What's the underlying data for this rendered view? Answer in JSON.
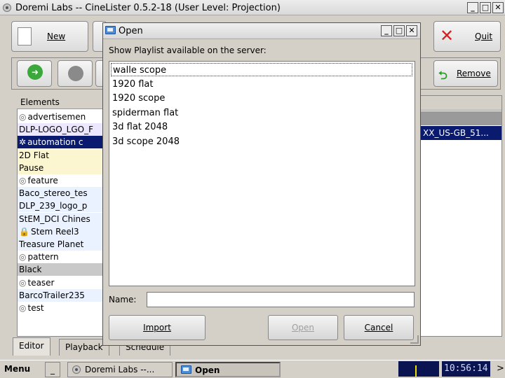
{
  "main_window": {
    "title": "Doremi Labs -- CineLister 0.5.2-18 (User Level: Projection)"
  },
  "toolbar": {
    "new_label": "New",
    "quit_label": "Quit",
    "remove_label": "Remove"
  },
  "elements_panel": {
    "header": "Elements",
    "items": [
      {
        "label": "advertisemen",
        "icon": "reel-icon",
        "bg": "#ffffff"
      },
      {
        "label": "DLP-LOGO_LGO_F",
        "icon": "",
        "bg": "#ece6ff"
      },
      {
        "label": "automation c",
        "icon": "gear-icon",
        "bg": "#0a1a6e"
      },
      {
        "label": "2D Flat",
        "icon": "",
        "bg": "#fbf6cf"
      },
      {
        "label": "Pause",
        "icon": "",
        "bg": "#fbf6cf"
      },
      {
        "label": "feature",
        "icon": "reel-icon",
        "bg": "#ffffff"
      },
      {
        "label": "Baco_stereo_tes",
        "icon": "",
        "bg": "#eaf1ff"
      },
      {
        "label": "DLP_239_logo_p",
        "icon": "",
        "bg": "#eaf1ff"
      },
      {
        "label": "StEM_DCI Chines",
        "icon": "",
        "bg": "#eaf1ff"
      },
      {
        "label": "Stem Reel3",
        "icon": "lock-icon",
        "bg": "#eaf1ff"
      },
      {
        "label": "Treasure Planet",
        "icon": "",
        "bg": "#eaf1ff"
      },
      {
        "label": "pattern",
        "icon": "reel-icon",
        "bg": "#ffffff"
      },
      {
        "label": "Black",
        "icon": "",
        "bg": "#c9c9c9"
      },
      {
        "label": "teaser",
        "icon": "reel-icon",
        "bg": "#ffffff"
      },
      {
        "label": "BarcoTrailer235",
        "icon": "",
        "bg": "#eaf1ff"
      },
      {
        "label": "test",
        "icon": "reel-icon",
        "bg": "#ffffff"
      }
    ]
  },
  "right_panel": {
    "selected_row": "XX_US-GB_51..."
  },
  "tabs": [
    "Editor",
    "Playback",
    "Schedule"
  ],
  "dialog": {
    "title": "Open",
    "prompt": "Show Playlist available on the server:",
    "playlists": [
      "walle scope",
      "1920 flat",
      "1920 scope",
      "spiderman flat",
      "3d flat 2048",
      "3d scope 2048"
    ],
    "selected_index": 0,
    "name_label": "Name:",
    "name_value": "",
    "import_label": "Import",
    "open_label": "Open",
    "cancel_label": "Cancel"
  },
  "taskbar": {
    "menu_label": "Menu",
    "minimize_label": "_",
    "task1": "Doremi Labs --...",
    "task2": "Open",
    "clock": "10:56:14",
    "overflow": ">"
  },
  "colors": {
    "selection": "#0a1a6e",
    "clock_bg": "#0a1450"
  }
}
